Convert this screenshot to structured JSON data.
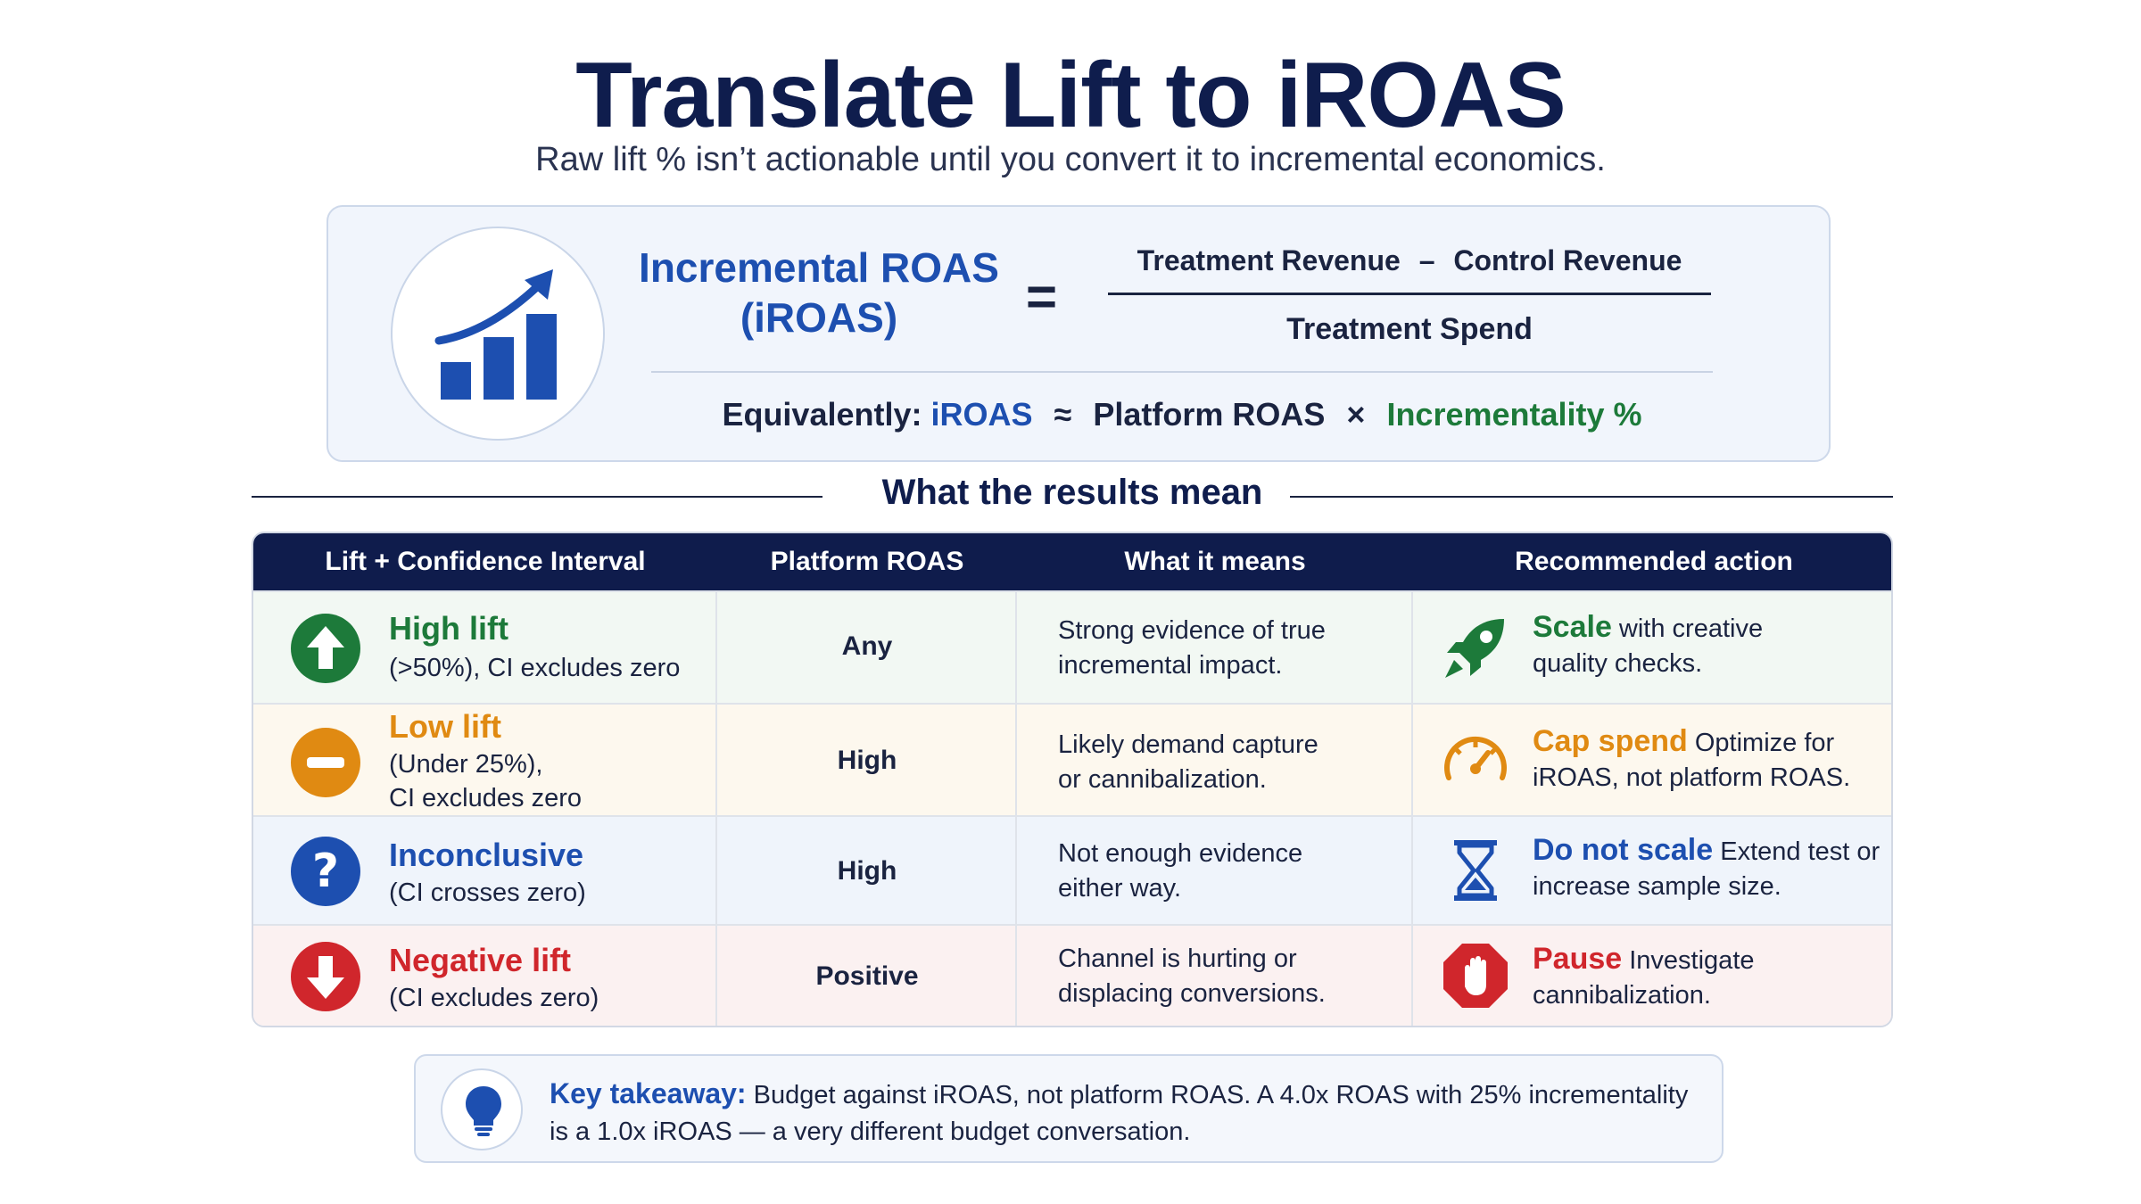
{
  "title": "Translate Lift to iROAS",
  "subtitle": "Raw lift % isn’t actionable until you convert it to incremental economics.",
  "formula": {
    "lhs_line1": "Incremental ROAS",
    "lhs_line2": "(iROAS)",
    "equals": "=",
    "numerator_a": "Treatment Revenue",
    "minus": "–",
    "numerator_b": "Control Revenue",
    "denominator": "Treatment Spend",
    "equiv_label": "Equivalently:",
    "equiv_iroas": "iROAS",
    "approx": "≈",
    "equiv_platform": "Platform ROAS",
    "times": "×",
    "equiv_incr": "Incrementality %"
  },
  "section_title": "What the results mean",
  "table": {
    "headers": [
      "Lift + Confidence Interval",
      "Platform ROAS",
      "What it means",
      "Recommended action"
    ],
    "rows": [
      {
        "icon": "arrow-up-icon",
        "status": "High lift",
        "detail_1": "(>50%), CI excludes zero",
        "detail_2": "",
        "roas": "Any",
        "meaning_1": "Strong evidence of true",
        "meaning_2": "incremental impact.",
        "action_icon": "rocket-icon",
        "action_kw": "Scale",
        "action_1": " with creative",
        "action_2": "quality checks."
      },
      {
        "icon": "minus-icon",
        "status": "Low lift",
        "detail_1": "(Under 25%),",
        "detail_2": "CI excludes zero",
        "roas": "High",
        "meaning_1": "Likely demand capture",
        "meaning_2": "or cannibalization.",
        "action_icon": "gauge-icon",
        "action_kw": "Cap spend",
        "action_1": " Optimize for",
        "action_2": "iROAS, not platform ROAS."
      },
      {
        "icon": "question-icon",
        "status": "Inconclusive",
        "detail_1": "(CI crosses zero)",
        "detail_2": "",
        "roas": "High",
        "meaning_1": "Not enough evidence",
        "meaning_2": "either way.",
        "action_icon": "hourglass-icon",
        "action_kw": "Do not scale",
        "action_1": " Extend test or",
        "action_2": "increase sample size."
      },
      {
        "icon": "arrow-down-icon",
        "status": "Negative lift",
        "detail_1": "(CI excludes zero)",
        "detail_2": "",
        "roas": "Positive",
        "meaning_1": "Channel is hurting or",
        "meaning_2": "displacing conversions.",
        "action_icon": "stop-hand-icon",
        "action_kw": "Pause",
        "action_1": " Investigate",
        "action_2": "cannibalization."
      }
    ]
  },
  "takeaway": {
    "label": "Key takeaway:",
    "text_1": " Budget against iROAS, not platform ROAS. A 4.0x ROAS with 25% incrementality",
    "text_2": "is a 1.0x iROAS — a very different budget conversation."
  },
  "colors": {
    "navy": "#0f1c4c",
    "blue": "#1d4fb0",
    "green": "#1d7a3a",
    "orange": "#e08a12",
    "red": "#d0262c"
  }
}
